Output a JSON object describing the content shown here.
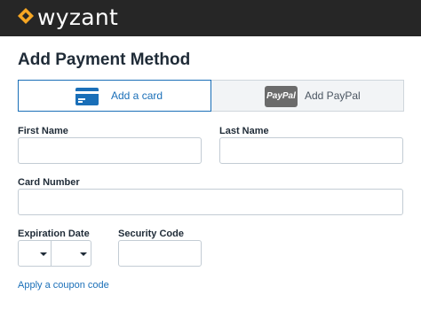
{
  "header": {
    "logo_text": "wyzant",
    "brand_color": "#f5a623",
    "bar_color": "#262626"
  },
  "page": {
    "title": "Add Payment Method"
  },
  "tabs": [
    {
      "label": "Add a card",
      "icon": "credit-card-icon",
      "selected": true
    },
    {
      "label": "Add PayPal",
      "icon": "paypal-icon",
      "badge": "PayPal",
      "selected": false
    }
  ],
  "form": {
    "first_name": {
      "label": "First Name",
      "value": ""
    },
    "last_name": {
      "label": "Last Name",
      "value": ""
    },
    "card_number": {
      "label": "Card Number",
      "value": ""
    },
    "expiration": {
      "label": "Expiration Date",
      "month": "",
      "year": ""
    },
    "security_code": {
      "label": "Security Code",
      "value": ""
    },
    "coupon_link": "Apply a coupon code"
  },
  "colors": {
    "accent": "#1a6fb8",
    "border": "#c3ccd4",
    "text": "#1f2b37"
  }
}
